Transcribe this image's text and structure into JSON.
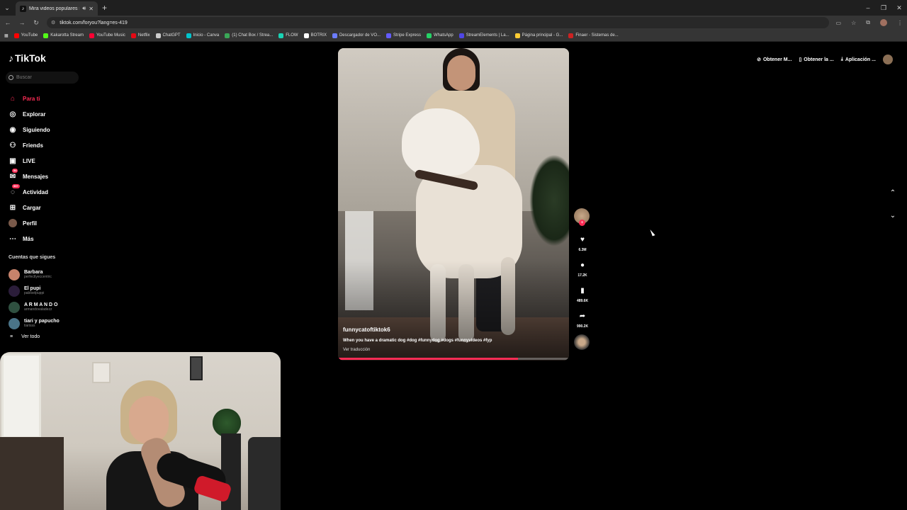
{
  "browser": {
    "tab_title": "Mira videos populares selec",
    "url": "tiktok.com/foryou?lang=es-419",
    "bookmarks": [
      {
        "label": "YouTube",
        "color": "#ff0000"
      },
      {
        "label": "Kakarotta Stream",
        "color": "#53fc18"
      },
      {
        "label": "YouTube Music",
        "color": "#ff0033"
      },
      {
        "label": "Netflix",
        "color": "#e50914"
      },
      {
        "label": "ChatGPT",
        "color": "#cccccc"
      },
      {
        "label": "Inicio - Canva",
        "color": "#00c4cc"
      },
      {
        "label": "(1) Chat Box / Strea...",
        "color": "#3aa757"
      },
      {
        "label": "FLOW",
        "color": "#19d3b4"
      },
      {
        "label": "BOTRIX",
        "color": "#ffffff"
      },
      {
        "label": "Descargador de VO...",
        "color": "#6b7cff"
      },
      {
        "label": "Stripe Express",
        "color": "#635bff"
      },
      {
        "label": "WhatsApp",
        "color": "#25d366"
      },
      {
        "label": "StreamElements | La...",
        "color": "#4f46e5"
      },
      {
        "label": "Página principal - G...",
        "color": "#ffcc33"
      },
      {
        "label": "Finaer - Sistemas de...",
        "color": "#cc2222"
      }
    ]
  },
  "tiktok": {
    "logo": "TikTok",
    "search_placeholder": "Buscar",
    "nav": [
      {
        "label": "Para ti",
        "icon": "home-icon",
        "active": true
      },
      {
        "label": "Explorar",
        "icon": "compass-icon"
      },
      {
        "label": "Siguiendo",
        "icon": "following-icon"
      },
      {
        "label": "Friends",
        "icon": "friends-icon"
      },
      {
        "label": "LIVE",
        "icon": "live-icon"
      },
      {
        "label": "Mensajes",
        "icon": "messages-icon",
        "badge": "54"
      },
      {
        "label": "Actividad",
        "icon": "activity-icon",
        "badge": "99+"
      },
      {
        "label": "Cargar",
        "icon": "upload-icon"
      },
      {
        "label": "Perfil",
        "icon": "profile-avatar"
      },
      {
        "label": "Más",
        "icon": "more-icon"
      }
    ],
    "following_title": "Cuentas que sigues",
    "following": [
      {
        "name": "Barbara",
        "user": "perfectlyeccentric",
        "color": "#c7836b"
      },
      {
        "name": "El pupi",
        "user": "pabloelpuppi",
        "color": "#2b1d3a"
      },
      {
        "name": "A R M A N D O",
        "user": "armandovaladezz",
        "color": "#2f5040"
      },
      {
        "name": "tiari y papucho",
        "user": "tiarisss",
        "color": "#4a7488"
      }
    ],
    "see_all": "Ver todo",
    "top_actions": [
      "Obtener M...",
      "Obtener la ...",
      "Aplicación ..."
    ],
    "video": {
      "username": "funnycatoftiktok6",
      "description": "When you have a dramatic dog #dog #funnydog #dogs #funnyvideos #fyp",
      "translate": "Ver traducción",
      "progress": 0.78
    },
    "actions": {
      "likes": "6.3M",
      "comments": "17.2K",
      "saves": "489.6K",
      "shares": "990.2K"
    }
  }
}
